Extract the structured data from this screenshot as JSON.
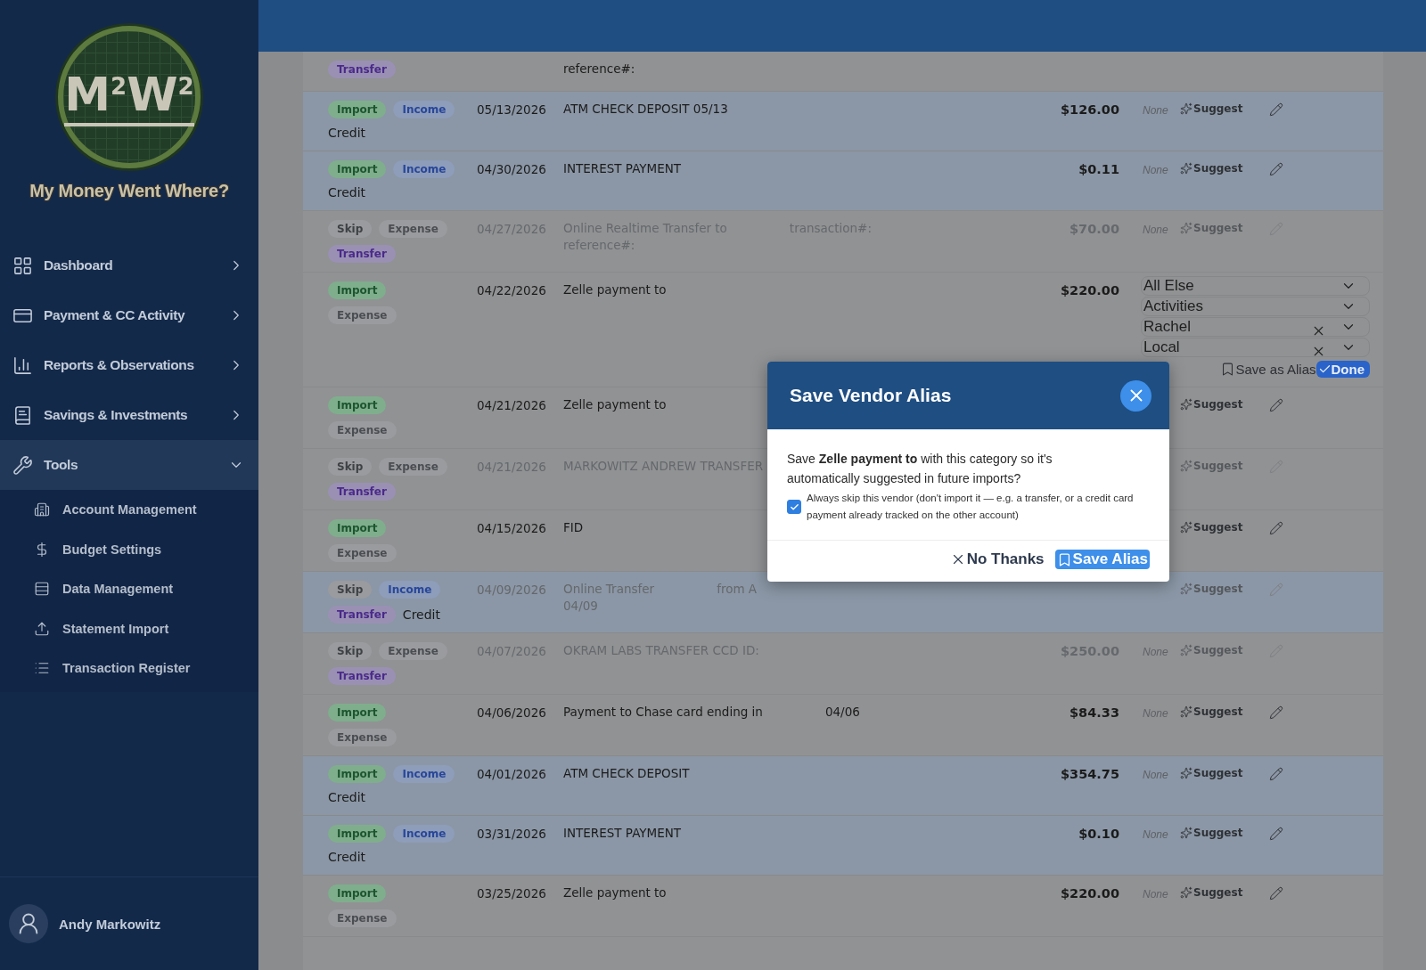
{
  "sidebar": {
    "logo": "M$^{2}$W$^{2}$",
    "app_name": "My Money Went Where?",
    "nav": [
      {
        "label": "Dashboard",
        "selected": false,
        "expanded": false
      },
      {
        "label": "Payment & CC Activity",
        "selected": false,
        "expanded": false
      },
      {
        "label": "Reports & Observations",
        "selected": false,
        "expanded": false
      },
      {
        "label": "Savings & Investments",
        "selected": false,
        "expanded": false
      },
      {
        "label": "Tools",
        "selected": true,
        "expanded": true,
        "children": [
          {
            "label": "Account Management",
            "selected": false
          },
          {
            "label": "Budget Settings",
            "selected": false
          },
          {
            "label": "Data Management",
            "selected": false
          },
          {
            "label": "Statement Import",
            "selected": false
          },
          {
            "label": "Transaction Register",
            "selected": false
          }
        ]
      }
    ],
    "user": {
      "name": "Andy Markowitz"
    }
  },
  "transactions": [
    {
      "kind": "partial",
      "tags": [
        [
          {
            "kind": "transfer",
            "label": "Transfer"
          }
        ]
      ],
      "desc": [
        [
          "reference#:"
        ]
      ]
    },
    {
      "kind": "normal",
      "tags": [
        [
          {
            "kind": "import",
            "label": "Import"
          },
          {
            "kind": "income",
            "label": "Income"
          }
        ],
        [
          {
            "kind": "text",
            "label": "Credit"
          }
        ]
      ],
      "date": "05/13/2026",
      "desc": [
        [
          "ATM CHECK DEPOSIT 05/13"
        ]
      ],
      "amount": "$126.00",
      "category": "None",
      "suggest": "Suggest"
    },
    {
      "kind": "normal",
      "tags": [
        [
          {
            "kind": "import",
            "label": "Import"
          },
          {
            "kind": "income",
            "label": "Income"
          }
        ],
        [
          {
            "kind": "text",
            "label": "Credit"
          }
        ]
      ],
      "date": "04/30/2026",
      "desc": [
        [
          "INTEREST PAYMENT"
        ]
      ],
      "amount": "$0.11",
      "category": "None",
      "suggest": "Suggest"
    },
    {
      "kind": "normal",
      "tags": [
        [
          {
            "kind": "skip",
            "label": "Skip"
          },
          {
            "kind": "expense",
            "label": "Expense"
          }
        ],
        [
          {
            "kind": "transfer",
            "label": "Transfer"
          }
        ]
      ],
      "date": "04/27/2026",
      "desc": [
        [
          "Online Realtime Transfer to",
          "transaction#:"
        ],
        [
          "reference#:"
        ]
      ],
      "amount": "$70.00",
      "category": "None",
      "suggest": "Suggest"
    },
    {
      "kind": "editing",
      "tags": [
        [
          {
            "kind": "import",
            "label": "Import"
          }
        ],
        [
          {
            "kind": "expense",
            "label": "Expense"
          }
        ]
      ],
      "date": "04/22/2026",
      "desc": [
        [
          "Zelle payment to"
        ]
      ],
      "amount": "$220.00",
      "fields": [
        {
          "value": "All Else",
          "clearable": false
        },
        {
          "value": "Activities",
          "clearable": false
        },
        {
          "value": "Rachel",
          "clearable": true
        },
        {
          "value": "Local",
          "clearable": true
        }
      ],
      "save_alias": "Save as Alias",
      "done": "Done"
    },
    {
      "kind": "normal",
      "tags": [
        [
          {
            "kind": "import",
            "label": "Import"
          }
        ],
        [
          {
            "kind": "expense",
            "label": "Expense"
          }
        ]
      ],
      "date": "04/21/2026",
      "desc": [
        [
          "Zelle payment to"
        ]
      ],
      "suggest": "Suggest"
    },
    {
      "kind": "normal",
      "tags": [
        [
          {
            "kind": "skip",
            "label": "Skip"
          },
          {
            "kind": "expense",
            "label": "Expense"
          }
        ],
        [
          {
            "kind": "transfer",
            "label": "Transfer"
          }
        ]
      ],
      "date": "04/21/2026",
      "desc": [
        [
          "MARKOWITZ ANDREW TRANSFER"
        ]
      ],
      "suggest": "Suggest"
    },
    {
      "kind": "normal",
      "tags": [
        [
          {
            "kind": "import",
            "label": "Import"
          }
        ],
        [
          {
            "kind": "expense",
            "label": "Expense"
          }
        ]
      ],
      "date": "04/15/2026",
      "desc": [
        [
          "FID"
        ]
      ],
      "suggest": "Suggest"
    },
    {
      "kind": "normal",
      "tags": [
        [
          {
            "kind": "skip",
            "label": "Skip"
          },
          {
            "kind": "income",
            "label": "Income"
          }
        ],
        [
          {
            "kind": "transfer",
            "label": "Transfer"
          },
          {
            "kind": "text",
            "label": "Credit"
          }
        ]
      ],
      "date": "04/09/2026",
      "desc": [
        [
          "Online Transfer",
          "from A"
        ],
        [
          "04/09"
        ]
      ],
      "suggest": "Suggest"
    },
    {
      "kind": "normal",
      "tags": [
        [
          {
            "kind": "skip",
            "label": "Skip"
          },
          {
            "kind": "expense",
            "label": "Expense"
          }
        ],
        [
          {
            "kind": "transfer",
            "label": "Transfer"
          }
        ]
      ],
      "date": "04/07/2026",
      "desc": [
        [
          "OKRAM LABS TRANSFER CCD ID:"
        ]
      ],
      "amount": "$250.00",
      "category": "None",
      "suggest": "Suggest"
    },
    {
      "kind": "normal",
      "tags": [
        [
          {
            "kind": "import",
            "label": "Import"
          }
        ],
        [
          {
            "kind": "expense",
            "label": "Expense"
          }
        ]
      ],
      "date": "04/06/2026",
      "desc": [
        [
          "Payment to Chase card ending in",
          "04/06"
        ]
      ],
      "amount": "$84.33",
      "category": "None",
      "suggest": "Suggest"
    },
    {
      "kind": "normal",
      "tags": [
        [
          {
            "kind": "import",
            "label": "Import"
          },
          {
            "kind": "income",
            "label": "Income"
          }
        ],
        [
          {
            "kind": "text",
            "label": "Credit"
          }
        ]
      ],
      "date": "04/01/2026",
      "desc": [
        [
          "ATM CHECK DEPOSIT"
        ]
      ],
      "amount": "$354.75",
      "category": "None",
      "suggest": "Suggest"
    },
    {
      "kind": "normal",
      "tags": [
        [
          {
            "kind": "import",
            "label": "Import"
          },
          {
            "kind": "income",
            "label": "Income"
          }
        ],
        [
          {
            "kind": "text",
            "label": "Credit"
          }
        ]
      ],
      "date": "03/31/2026",
      "desc": [
        [
          "INTEREST PAYMENT"
        ]
      ],
      "amount": "$0.10",
      "category": "None",
      "suggest": "Suggest"
    },
    {
      "kind": "normal",
      "tags": [
        [
          {
            "kind": "import",
            "label": "Import"
          }
        ],
        [
          {
            "kind": "expense",
            "label": "Expense"
          }
        ]
      ],
      "date": "03/25/2026",
      "desc": [
        [
          "Zelle payment to"
        ]
      ],
      "amount": "$220.00",
      "category": "None",
      "suggest": "Suggest"
    }
  ],
  "modal": {
    "title": "Save Vendor Alias",
    "message": "Save **Zelle payment to** with this category so it's automatically suggested in future imports?",
    "skip_checkbox": {
      "label": "Always skip this vendor (don't import it — e.g. a transfer, or a credit card payment already tracked on the other account)",
      "checked": true
    },
    "buttons": [
      {
        "kind": "secondary",
        "label": "No Thanks"
      },
      {
        "kind": "primary",
        "label": "Save Alias"
      }
    ]
  }
}
